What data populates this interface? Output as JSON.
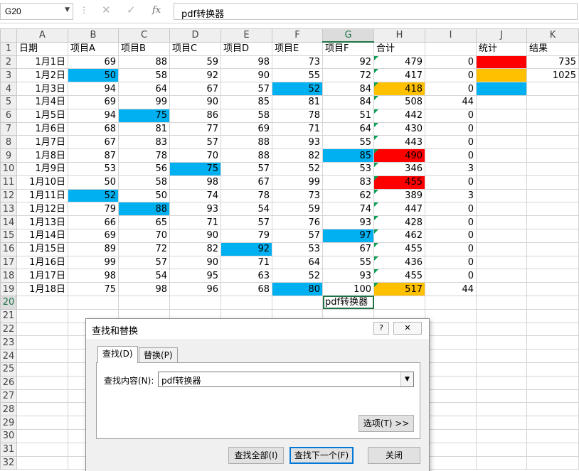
{
  "formula_bar": {
    "name_box": "G20",
    "cancel_icon": "✕",
    "enter_icon": "✓",
    "fx_icon": "fx",
    "content": "pdf转换器"
  },
  "columns": [
    "A",
    "B",
    "C",
    "D",
    "E",
    "F",
    "G",
    "H",
    "I",
    "J",
    "K"
  ],
  "header_row": [
    "日期",
    "项目A",
    "项目B",
    "项目C",
    "项目D",
    "项目E",
    "项目F",
    "合计",
    "",
    "统计",
    "结果"
  ],
  "rows": [
    {
      "date": "1月1日",
      "vals": [
        69,
        88,
        59,
        98,
        73,
        92
      ],
      "sum": 479,
      "i": 0,
      "k": "735",
      "j": "red"
    },
    {
      "date": "1月2日",
      "vals": [
        50,
        58,
        92,
        90,
        55,
        72
      ],
      "sum": 417,
      "i": 0,
      "k": "1025",
      "j": "orange"
    },
    {
      "date": "1月3日",
      "vals": [
        94,
        64,
        67,
        57,
        52,
        84
      ],
      "sum": 418,
      "i": 0,
      "k": "",
      "j": "blue"
    },
    {
      "date": "1月4日",
      "vals": [
        69,
        99,
        90,
        85,
        81,
        84
      ],
      "sum": 508,
      "i": 44,
      "k": "",
      "j": ""
    },
    {
      "date": "1月5日",
      "vals": [
        94,
        75,
        86,
        58,
        78,
        51
      ],
      "sum": 442,
      "i": 0,
      "k": "",
      "j": ""
    },
    {
      "date": "1月6日",
      "vals": [
        68,
        81,
        77,
        69,
        71,
        64
      ],
      "sum": 430,
      "i": 0,
      "k": "",
      "j": ""
    },
    {
      "date": "1月7日",
      "vals": [
        67,
        83,
        57,
        88,
        93,
        55
      ],
      "sum": 443,
      "i": 0,
      "k": "",
      "j": ""
    },
    {
      "date": "1月8日",
      "vals": [
        87,
        78,
        70,
        88,
        82,
        85
      ],
      "sum": 490,
      "i": 0,
      "k": "",
      "j": ""
    },
    {
      "date": "1月9日",
      "vals": [
        53,
        56,
        75,
        57,
        52,
        53
      ],
      "sum": 346,
      "i": 3,
      "k": "",
      "j": ""
    },
    {
      "date": "1月10日",
      "vals": [
        50,
        58,
        98,
        67,
        99,
        83
      ],
      "sum": 455,
      "i": 0,
      "k": "",
      "j": ""
    },
    {
      "date": "1月11日",
      "vals": [
        52,
        50,
        74,
        78,
        73,
        62
      ],
      "sum": 389,
      "i": 3,
      "k": "",
      "j": ""
    },
    {
      "date": "1月12日",
      "vals": [
        79,
        88,
        93,
        54,
        59,
        74
      ],
      "sum": 447,
      "i": 0,
      "k": "",
      "j": ""
    },
    {
      "date": "1月13日",
      "vals": [
        66,
        65,
        71,
        57,
        76,
        93
      ],
      "sum": 428,
      "i": 0,
      "k": "",
      "j": ""
    },
    {
      "date": "1月14日",
      "vals": [
        69,
        70,
        90,
        79,
        57,
        97
      ],
      "sum": 462,
      "i": 0,
      "k": "",
      "j": ""
    },
    {
      "date": "1月15日",
      "vals": [
        89,
        72,
        82,
        92,
        53,
        67
      ],
      "sum": 455,
      "i": 0,
      "k": "",
      "j": ""
    },
    {
      "date": "1月16日",
      "vals": [
        99,
        57,
        90,
        71,
        64,
        55
      ],
      "sum": 436,
      "i": 0,
      "k": "",
      "j": ""
    },
    {
      "date": "1月17日",
      "vals": [
        98,
        54,
        95,
        63,
        52,
        93
      ],
      "sum": 455,
      "i": 0,
      "k": "",
      "j": ""
    },
    {
      "date": "1月18日",
      "vals": [
        75,
        98,
        96,
        68,
        80,
        100
      ],
      "sum": 517,
      "i": 44,
      "k": "",
      "j": ""
    }
  ],
  "highlight_colors": {
    "blue": "#00b0f0",
    "red": "#ff0000",
    "orange": "#ffc000"
  },
  "blue_cells": [
    [
      1,
      0
    ],
    [
      2,
      4
    ],
    [
      4,
      1
    ],
    [
      7,
      5
    ],
    [
      8,
      2
    ],
    [
      10,
      0
    ],
    [
      11,
      1
    ],
    [
      13,
      5
    ],
    [
      14,
      3
    ],
    [
      17,
      4
    ],
    [
      18,
      2
    ]
  ],
  "sum_fill": {
    "4": "orange",
    "9": "red",
    "11": "red",
    "19": "orange"
  },
  "active_cell": {
    "row": 20,
    "col": "G",
    "content": "pdf转换器"
  },
  "row_numbers": [
    1,
    2,
    3,
    4,
    5,
    6,
    7,
    8,
    9,
    10,
    11,
    12,
    13,
    14,
    15,
    16,
    17,
    18,
    19,
    20,
    21,
    22,
    23,
    24,
    25,
    26,
    27,
    28,
    29,
    30,
    31,
    32
  ],
  "dialog": {
    "title": "查找和替换",
    "help_button": "?",
    "close_x": "✕",
    "tab_find": "查找(D)",
    "tab_replace": "替换(P)",
    "find_label": "查找内容(N):",
    "find_value": "pdf转换器",
    "options_button": "选项(T) >>",
    "find_all_button": "查找全部(I)",
    "find_next_button": "查找下一个(F)",
    "close_button": "关闭"
  }
}
